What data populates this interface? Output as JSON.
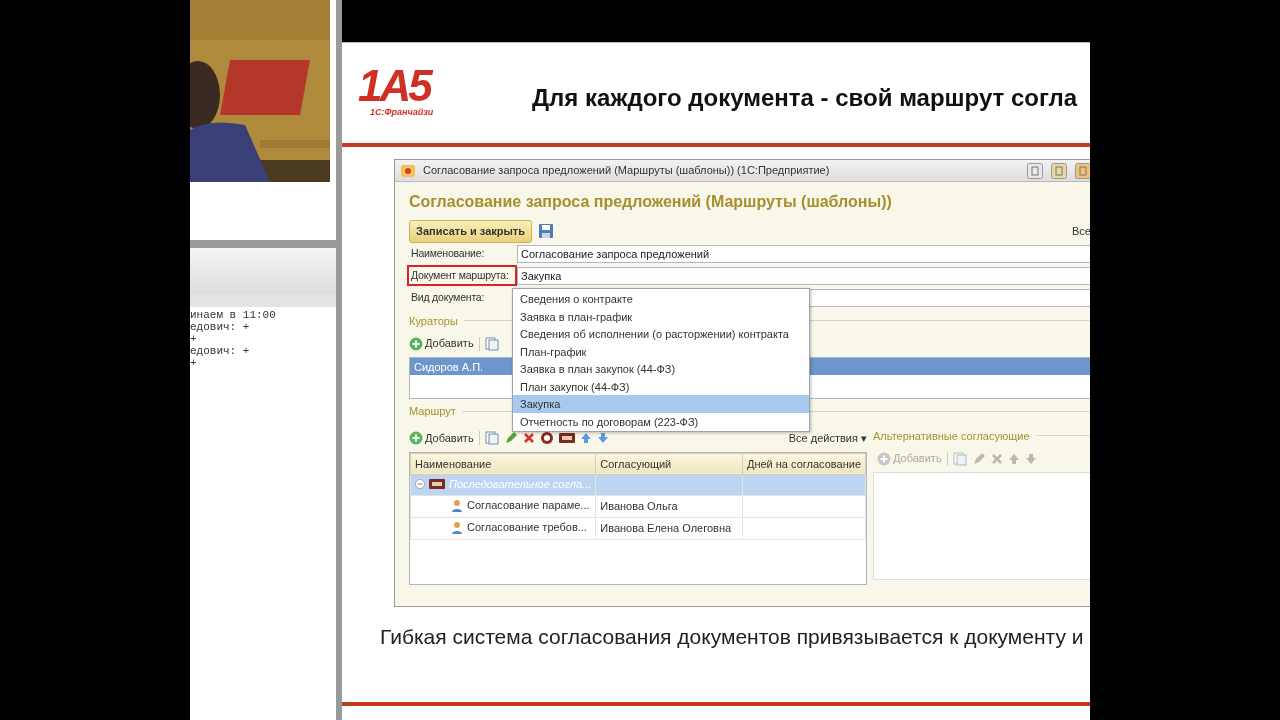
{
  "webinar": {
    "chat_lines": [
      "инаем в 11:00",
      "едович: +",
      "+",
      "едович: +",
      "+"
    ]
  },
  "slide": {
    "logo": {
      "mark": "1А5",
      "caption": "1С:Франчайзи"
    },
    "title": "Для каждого документа - свой маршрут согла",
    "caption": "Гибкая система согласования документов  привязывается к документу  и"
  },
  "app_window": {
    "title": "Согласование запроса предложений (Маршруты (шаблоны))  (1С:Предприятие)",
    "form_title": "Согласование запроса предложений (Маршруты (шаблоны))",
    "save_close": "Записать и закрыть",
    "all_menu": "Все",
    "fields": [
      {
        "label": "Наименование:",
        "value": "Согласование запроса предложений",
        "highlighted": false
      },
      {
        "label": "Документ маршрута:",
        "value": "Закупка",
        "highlighted": true
      },
      {
        "label": "Вид документа:",
        "highlighted": false
      }
    ],
    "dropdown": {
      "items": [
        {
          "label": "Сведения о контракте",
          "selected": false
        },
        {
          "label": "Заявка в план-график",
          "selected": false
        },
        {
          "label": "Сведения об исполнении (о расторжении) контракта",
          "selected": false
        },
        {
          "label": "План-график",
          "selected": false
        },
        {
          "label": "Заявка в план закупок (44-ФЗ)",
          "selected": false
        },
        {
          "label": "План закупок (44-ФЗ)",
          "selected": false
        },
        {
          "label": "Закупка",
          "selected": true
        },
        {
          "label": "Отчетность по договорам (223-ФЗ)",
          "selected": false
        }
      ]
    },
    "curators": {
      "title": "Кураторы",
      "add": "Добавить",
      "rows": [
        {
          "name": "Сидоров А.П.",
          "selected": true
        }
      ]
    },
    "route": {
      "title": "Маршрут",
      "add": "Добавить",
      "all_actions": "Все действия ▾",
      "columns": [
        "Наименование",
        "Согласующий",
        "Дней на согласование"
      ],
      "rows": [
        {
          "kind": "group",
          "name": "Последовательное согла...",
          "expanded": true,
          "selected": true,
          "children": [
            {
              "kind": "person",
              "name": "Согласование параме...",
              "approver": "Иванова Ольга",
              "selected": false
            },
            {
              "kind": "person",
              "name": "Согласование требов...",
              "approver": "Иванова Елена Олеговна",
              "selected": false
            }
          ]
        }
      ]
    },
    "alternatives": {
      "title": "Альтернативные согласующие",
      "add": "Добавить",
      "disabled": true
    }
  }
}
